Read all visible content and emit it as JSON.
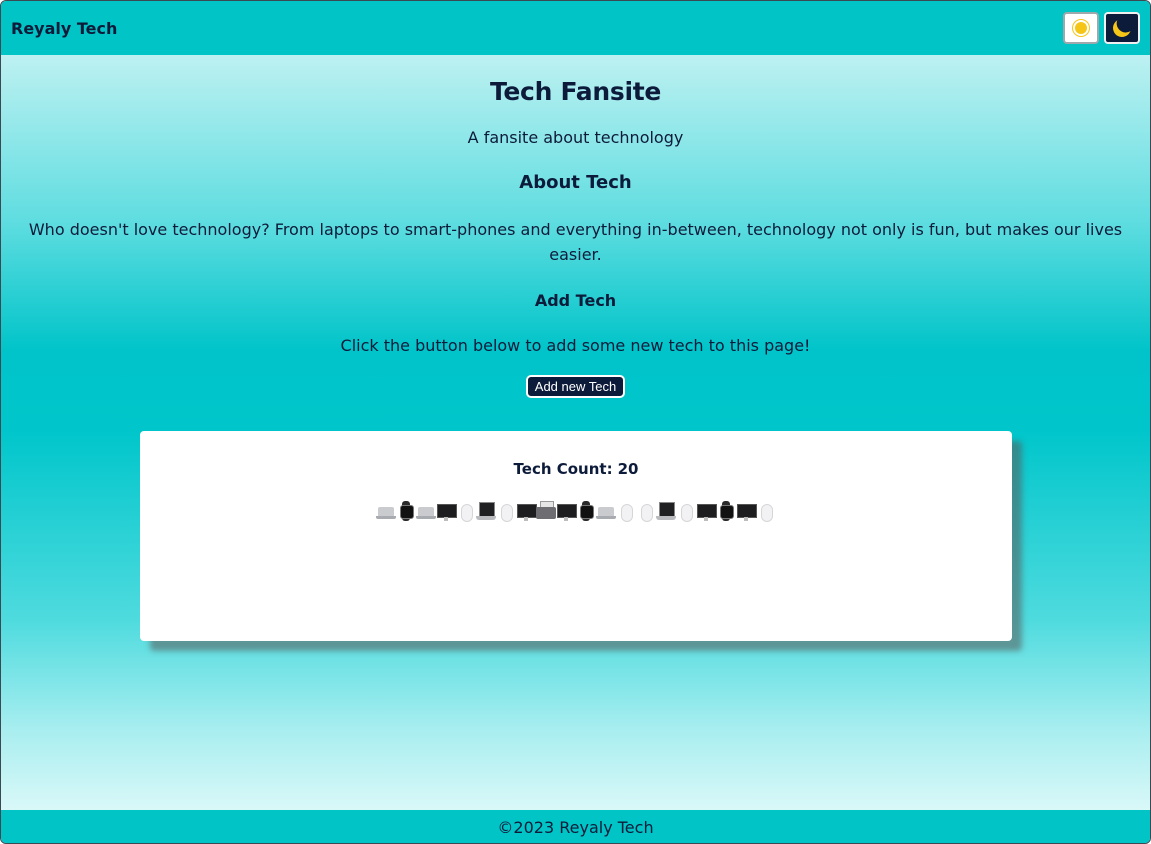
{
  "header": {
    "brand": "Reyaly Tech",
    "light_mode_icon": "sun-icon",
    "dark_mode_icon": "moon-icon"
  },
  "main": {
    "title": "Tech Fansite",
    "subtitle": "A fansite about technology",
    "about_heading": "About Tech",
    "about_text": "Who doesn't love technology? From laptops to smart-phones and everything in-between, technology not only is fun, but makes our lives easier.",
    "add_heading": "Add Tech",
    "add_text": "Click the button below to add some new tech to this page!",
    "add_button_label": "Add new Tech"
  },
  "tech_card": {
    "count_label": "Tech Count:",
    "count_value": "20",
    "items": [
      "laptop",
      "watch",
      "laptop",
      "monitor",
      "mouse",
      "macbook",
      "mouse",
      "monitor",
      "printer",
      "monitor",
      "watch",
      "laptop",
      "mouse",
      "mouse",
      "macbook",
      "mouse",
      "monitor",
      "watch",
      "monitor",
      "mouse"
    ]
  },
  "footer": {
    "copyright": "©2023 Reyaly Tech"
  },
  "colors": {
    "header_bg": "#00c4c6",
    "text_dark": "#0d1b3a",
    "button_bg": "#0d1b3a"
  }
}
